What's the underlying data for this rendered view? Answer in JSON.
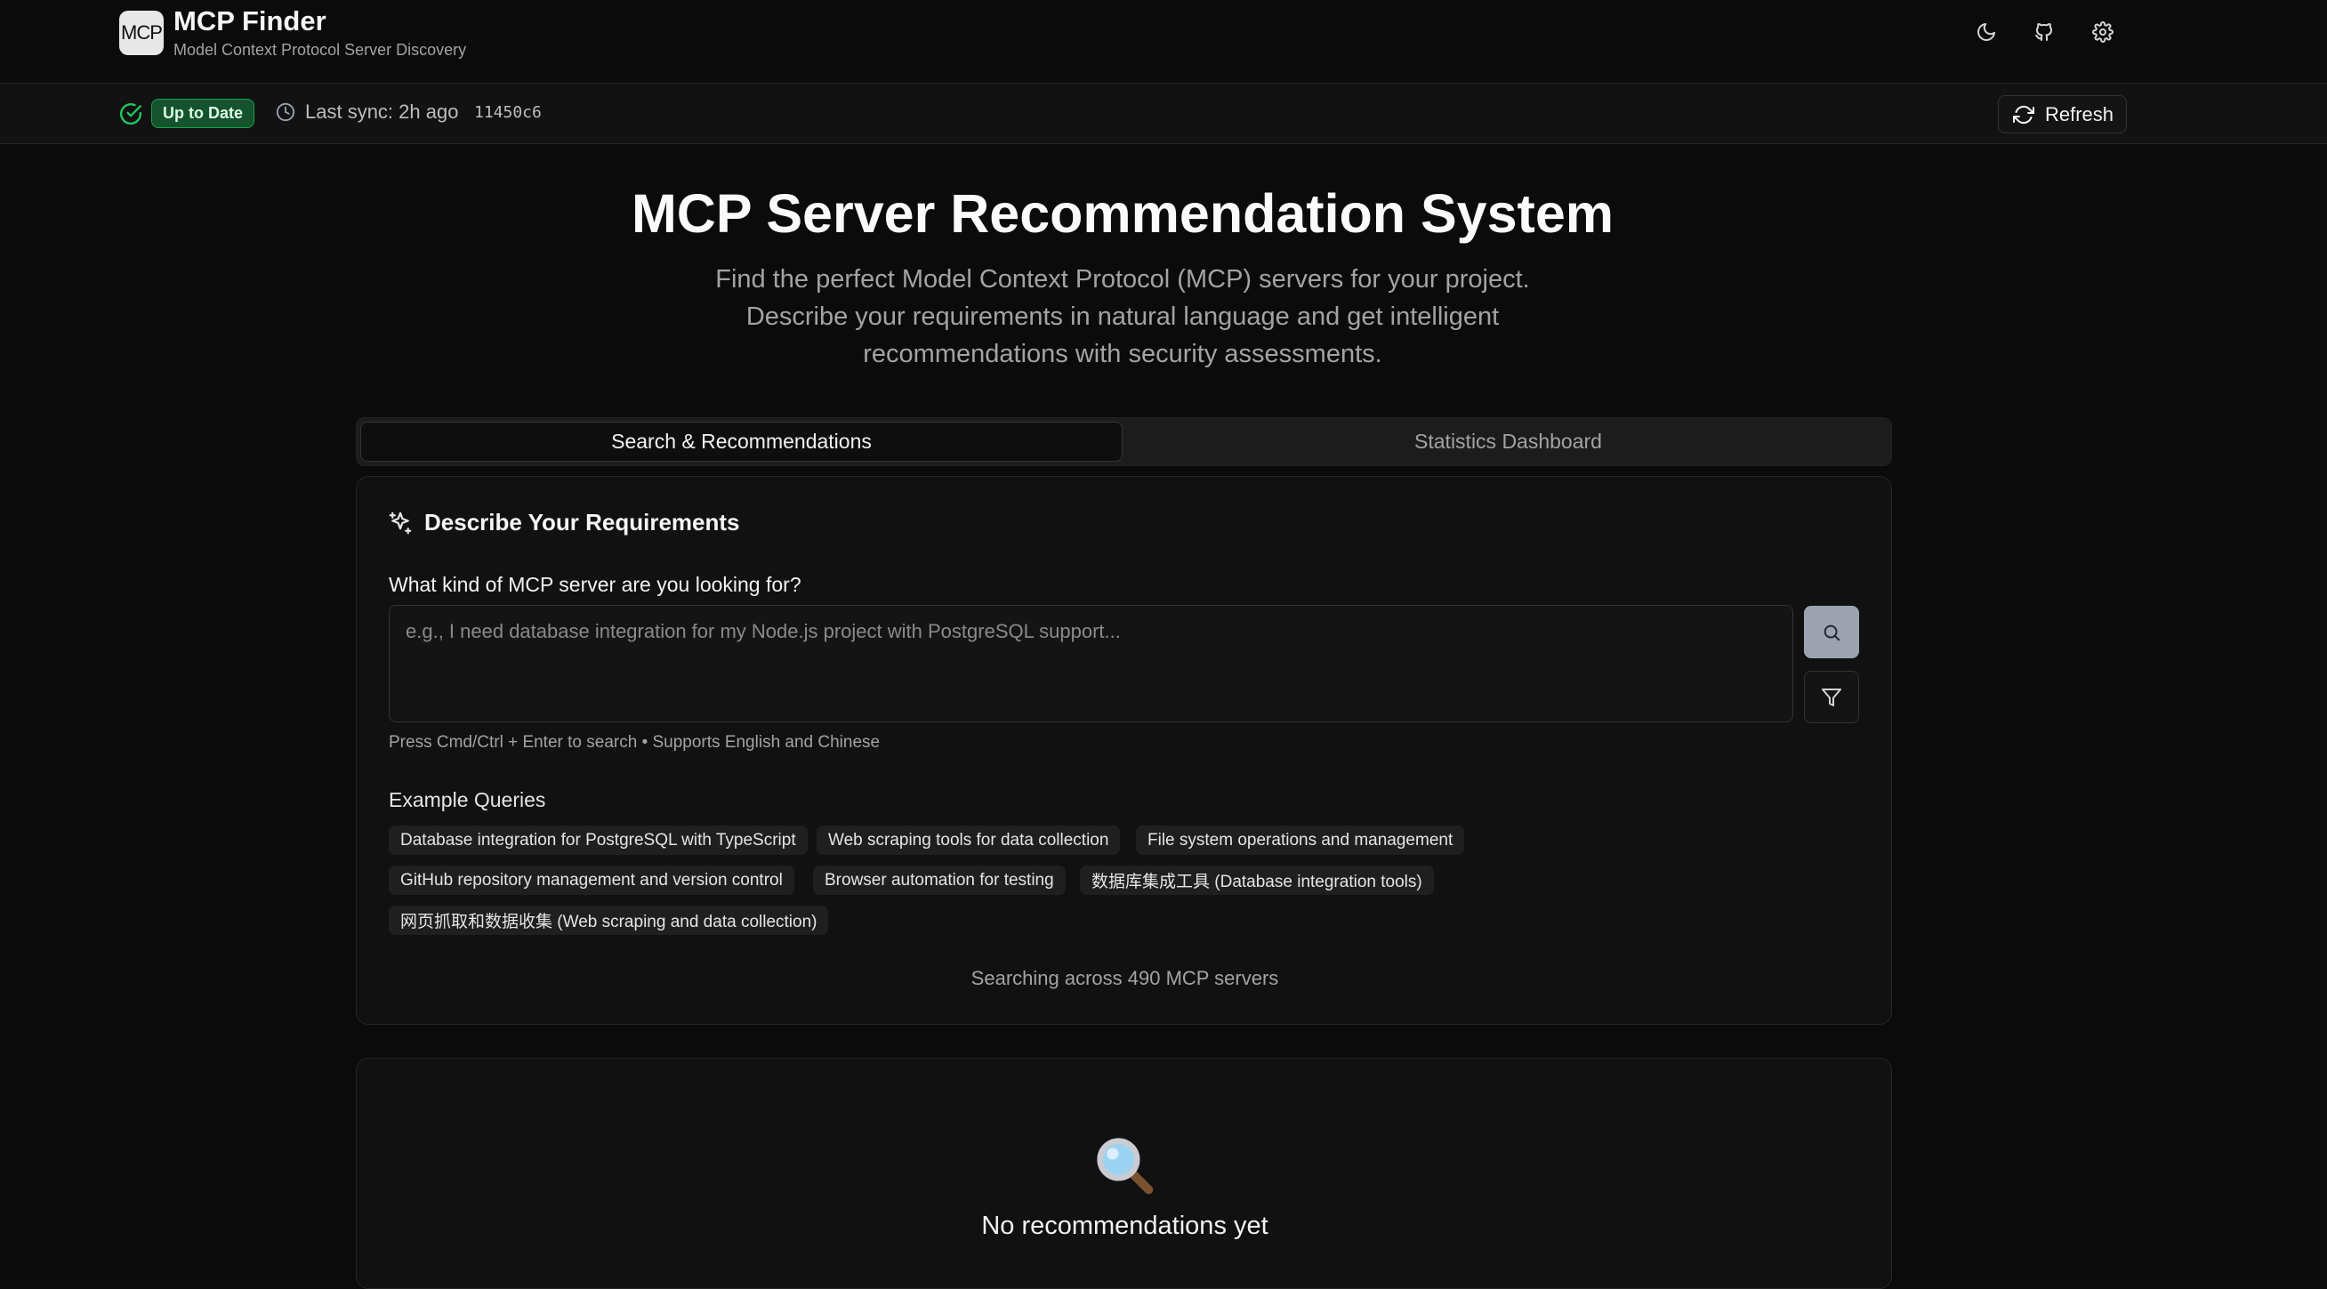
{
  "header": {
    "logo_text": "MCP",
    "title": "MCP Finder",
    "subtitle": "Model Context Protocol Server Discovery",
    "icons": [
      "moon-icon",
      "github-icon",
      "gear-icon"
    ]
  },
  "status": {
    "badge": "Up to Date",
    "last_sync": "Last sync: 2h ago",
    "commit": "11450c6",
    "refresh_label": "Refresh",
    "badge_color": "#22c55e"
  },
  "hero": {
    "title": "MCP Server Recommendation System",
    "description": "Find the perfect Model Context Protocol (MCP) servers for your project. Describe your requirements in natural language and get intelligent recommendations with security assessments."
  },
  "tabs": [
    {
      "label": "Search & Recommendations",
      "active": true
    },
    {
      "label": "Statistics Dashboard",
      "active": false
    }
  ],
  "search": {
    "section_title": "Describe Your Requirements",
    "field_label": "What kind of MCP server are you looking for?",
    "placeholder": "e.g., I need database integration for my Node.js project with PostgreSQL support...",
    "value": "",
    "hint": "Press Cmd/Ctrl + Enter to search • Supports English and Chinese",
    "examples_title": "Example Queries",
    "examples": [
      "Database integration for PostgreSQL with TypeScript",
      "Web scraping tools for data collection",
      "File system operations and management",
      "GitHub repository management and version control",
      "Browser automation for testing",
      "数据库集成工具 (Database integration tools)",
      "网页抓取和数据收集 (Web scraping and data collection)"
    ],
    "searching_text": "Searching across 490 MCP servers"
  },
  "results": {
    "empty_text": "No recommendations yet"
  }
}
